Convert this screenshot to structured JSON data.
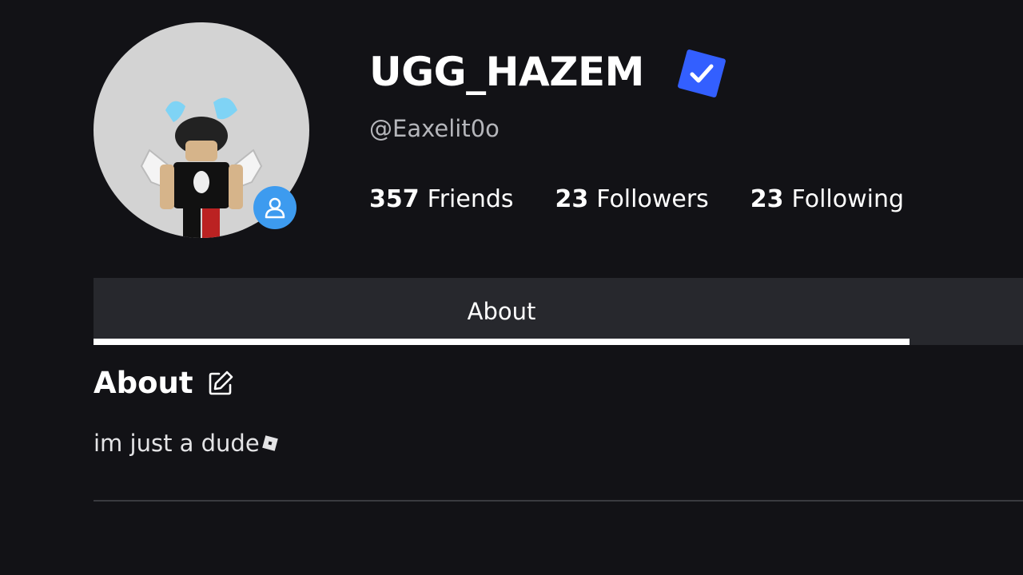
{
  "profile": {
    "display_name": "UGG_HAZEM",
    "username": "@Eaxelit0o",
    "verified": true,
    "presence_icon": "user-presence-icon",
    "avatar_icon": "avatar-image"
  },
  "stats": [
    {
      "count": "357",
      "label": "Friends"
    },
    {
      "count": "23",
      "label": "Followers"
    },
    {
      "count": "23",
      "label": "Following"
    }
  ],
  "tabs": [
    {
      "label": "About",
      "active": true
    }
  ],
  "about": {
    "heading": "About",
    "edit_icon": "edit-icon",
    "text": "im just a dude",
    "trailing_icon": "roblox-logo-icon"
  },
  "colors": {
    "background": "#121216",
    "tab_bar": "#27282d",
    "verified_blue": "#335fff",
    "presence_blue": "#3d9bef",
    "muted_text": "#b5b6bb"
  }
}
